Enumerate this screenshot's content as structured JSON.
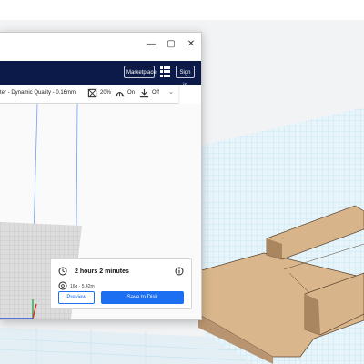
{
  "window": {
    "controls": {
      "minimize": "—",
      "maximize": "▢",
      "close": "✕"
    }
  },
  "header": {
    "marketplace_label": "Marketplace",
    "signin_label": "Sign in"
  },
  "print_settings": {
    "profile": "ter - Dynamic Quality - 0.16mm",
    "infill": "20%",
    "support": "On",
    "adhesion": "Off"
  },
  "action_panel": {
    "print_time": "2 hours 2 minutes",
    "material": "16g · 5.42m",
    "preview_label": "Preview",
    "save_label": "Save to Disk"
  },
  "colors": {
    "header_bg": "#0c1a49",
    "accent_blue": "#1c6ff1",
    "model_tan": "#d7b48a",
    "grid_blue": "#cfe9f3"
  }
}
